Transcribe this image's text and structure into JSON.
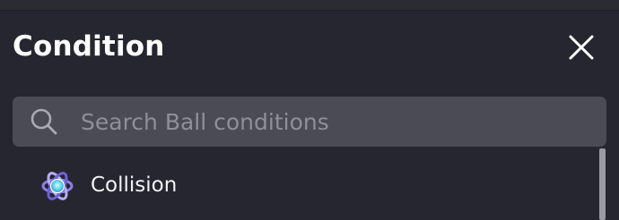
{
  "panel": {
    "title": "Condition",
    "close_icon": "close-icon"
  },
  "search": {
    "placeholder": "Search Ball conditions",
    "value": "",
    "icon": "search-icon"
  },
  "conditions": [
    {
      "label": "Collision",
      "icon": "atom-icon"
    }
  ],
  "colors": {
    "background": "#262630",
    "search_field": "#4b4b56",
    "placeholder": "#8f8f9a",
    "text": "#ffffff",
    "icon_accent": "#5fd6f0",
    "icon_ring": "#8c7ee8"
  }
}
